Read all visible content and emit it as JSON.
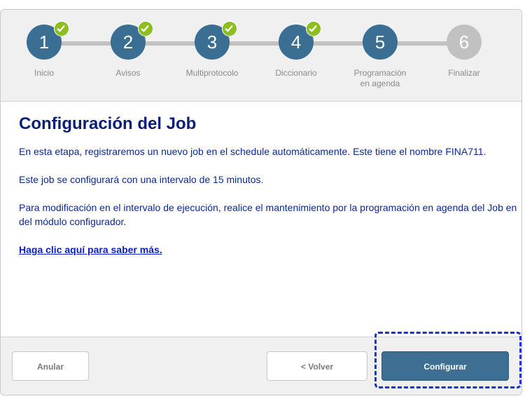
{
  "wizard": {
    "steps": [
      {
        "number": "1",
        "label": "Inicio",
        "state": "done"
      },
      {
        "number": "2",
        "label": "Avisos",
        "state": "done"
      },
      {
        "number": "3",
        "label": "Multiprotocolo",
        "state": "done"
      },
      {
        "number": "4",
        "label": "Diccionario",
        "state": "done"
      },
      {
        "number": "5",
        "label": "Programación\nen agenda",
        "state": "current"
      },
      {
        "number": "6",
        "label": "Finalizar",
        "state": "future"
      }
    ]
  },
  "main": {
    "title": "Configuración del Job",
    "paragraph1": "En esta etapa, registraremos un nuevo job en el schedule automáticamente. Este tiene el nombre FINA711.",
    "paragraph2": "Este job se configurará con una intervalo de 15 minutos.",
    "paragraph3_line1": "Para modificación en el intervalo de ejecución, realice el mantenimiento por la programación en agenda del Job en",
    "paragraph3_line2": "del módulo configurador.",
    "link": "Haga clic aquí para saber más. "
  },
  "footer": {
    "cancel_label": "Anular",
    "back_label": "< Volver",
    "configure_label": "Configurar"
  },
  "colors": {
    "step_active": "#3a6f93",
    "step_future": "#c1c1c1",
    "check_badge": "#8cbf1e",
    "title": "#0a1f7a",
    "primary_button": "#3e6f92",
    "highlight_border": "#1a32d6"
  },
  "icons": {
    "step_complete": "check-icon"
  }
}
